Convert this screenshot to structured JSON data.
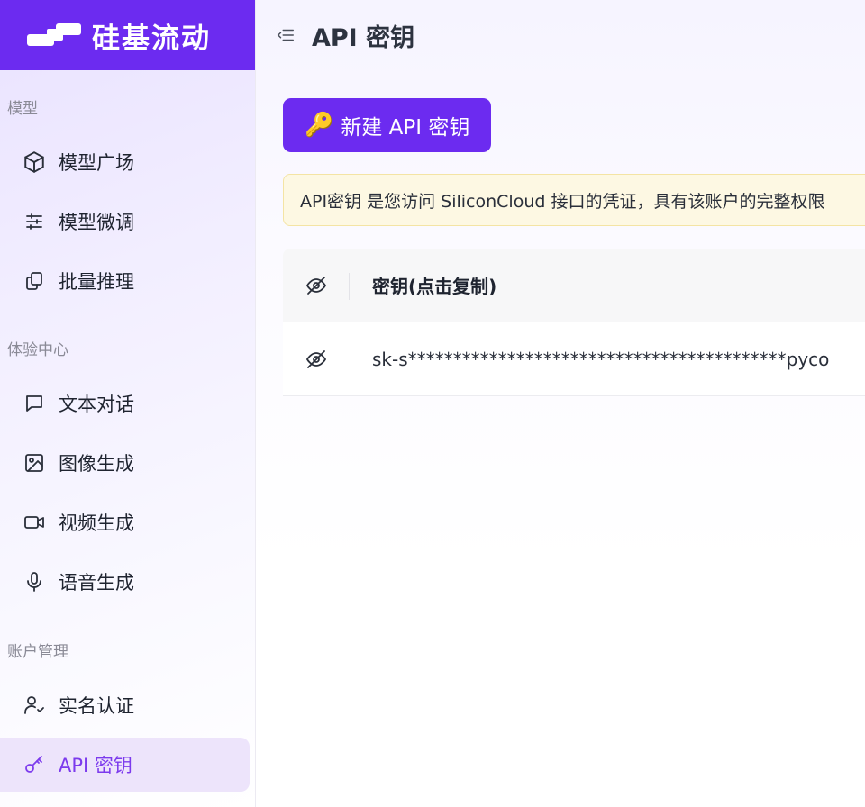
{
  "brand": {
    "name": "硅基流动",
    "color": "#6c2bf0"
  },
  "sidebar": {
    "sections": [
      {
        "title": "模型"
      },
      {
        "title": "体验中心"
      },
      {
        "title": "账户管理"
      }
    ],
    "items": [
      {
        "label": "模型广场",
        "icon": "cube-icon"
      },
      {
        "label": "模型微调",
        "icon": "sliders-icon"
      },
      {
        "label": "批量推理",
        "icon": "copy-stack-icon"
      },
      {
        "label": "文本对话",
        "icon": "chat-icon"
      },
      {
        "label": "图像生成",
        "icon": "image-icon"
      },
      {
        "label": "视频生成",
        "icon": "video-icon"
      },
      {
        "label": "语音生成",
        "icon": "microphone-icon"
      },
      {
        "label": "实名认证",
        "icon": "user-check-icon"
      },
      {
        "label": "API 密钥",
        "icon": "key-icon",
        "active": true
      }
    ]
  },
  "header": {
    "title": "API 密钥"
  },
  "main": {
    "new_key_button": {
      "emoji": "🔑",
      "label": "新建 API 密钥"
    },
    "notice": "API密钥 是您访问 SiliconCloud 接口的凭证，具有该账户的完整权限",
    "table": {
      "header_label": "密钥(点击复制)",
      "rows": [
        {
          "key": "sk-s******************************************pyco"
        }
      ]
    }
  }
}
